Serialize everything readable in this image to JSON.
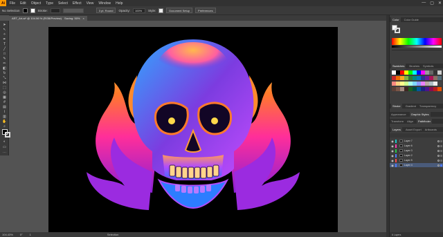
{
  "app": {
    "logo": "Ai"
  },
  "menu": {
    "items": [
      "File",
      "Edit",
      "Object",
      "Type",
      "Select",
      "Effect",
      "View",
      "Window",
      "Help"
    ]
  },
  "window_controls": [
    "—",
    "▢",
    "✕"
  ],
  "control_bar": {
    "selection": "No Selection",
    "stroke_label": "Stroke:",
    "brush": "3 pt. Round",
    "opacity_label": "Opacity:",
    "opacity_value": "100%",
    "style_label": "Style:",
    "document_setup": "Document Setup",
    "preferences": "Preferences"
  },
  "document_tab": {
    "label": "ART_Art.ai* @ 104.56 % (RGB/Preview)",
    "saving": "Saving: 50%",
    "close": "×"
  },
  "status_bar": {
    "zoom": "104.43%",
    "angle": "0°",
    "page": "1",
    "tool": "Selection"
  },
  "panels": {
    "color_tabs": [
      "Color",
      "Color Guide"
    ],
    "swatch_tabs": [
      "Swatches",
      "Brushes",
      "Symbols"
    ],
    "stroke_tabs": [
      "Stroke",
      "Gradient",
      "Transparency"
    ],
    "appearance_tabs": [
      "Appearance",
      "Graphic Styles"
    ],
    "transform_tabs": [
      "Transform",
      "Align",
      "Pathfinder"
    ],
    "layers_tabs": [
      "Layers",
      "Asset Export",
      "Artboards"
    ],
    "layers": [
      {
        "name": "Layer 7",
        "color": "#1ec8c8"
      },
      {
        "name": "Layer 6",
        "color": "#ff3fb0"
      },
      {
        "name": "Layer 3",
        "color": "#27c94a"
      },
      {
        "name": "Layer 2",
        "color": "#4f7bff"
      },
      {
        "name": "Layer 5",
        "color": "#ff4a4a"
      },
      {
        "name": "Layer 4",
        "color": "#4f7bff"
      }
    ],
    "layers_footer": "6 Layers"
  },
  "colors": {
    "accent": "#ff9a00",
    "artboard": "#000000",
    "pasteboard": "#535353"
  }
}
